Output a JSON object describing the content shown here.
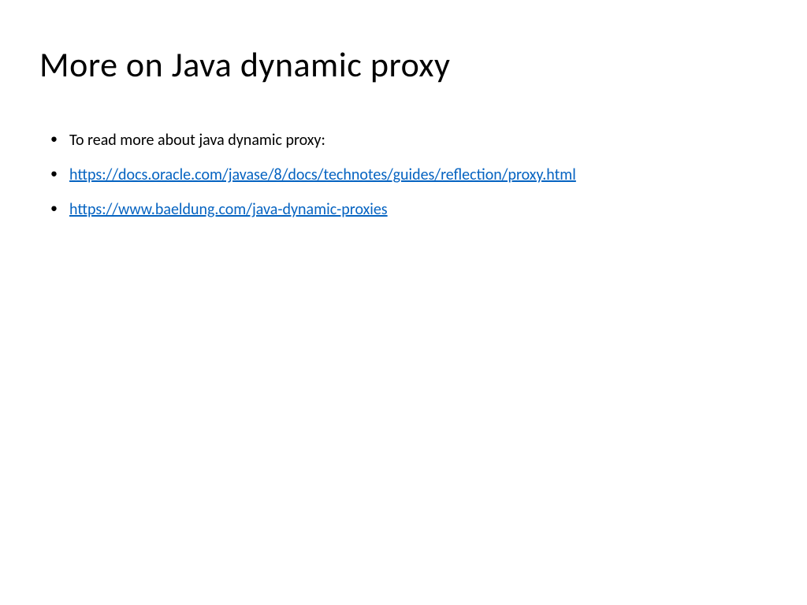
{
  "slide": {
    "title": "More on Java dynamic proxy",
    "bullets": [
      {
        "type": "text",
        "content": "To read more about java dynamic proxy:"
      },
      {
        "type": "link",
        "content": "https://docs.oracle.com/javase/8/docs/technotes/guides/reflection/proxy.html"
      },
      {
        "type": "link",
        "content": "https://www.baeldung.com/java-dynamic-proxies"
      }
    ]
  }
}
